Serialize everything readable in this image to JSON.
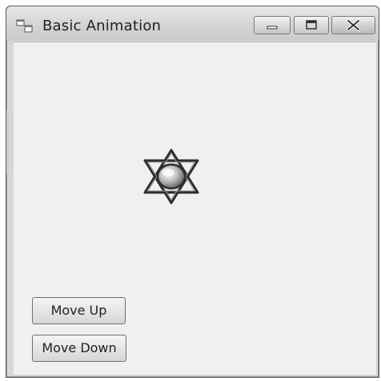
{
  "window": {
    "title": "Basic Animation",
    "icons": {
      "app": "app-window-icon",
      "minimize": "minimize-icon",
      "maximize": "maximize-icon",
      "close": "close-icon",
      "sprite": "star-orb-sprite"
    }
  },
  "controls": {
    "move_up_label": "Move Up",
    "move_down_label": "Move Down"
  },
  "colors": {
    "client_background": "#f0f0f0",
    "titlebar": "#d6d6d6",
    "sprite_stroke": "#333333"
  }
}
